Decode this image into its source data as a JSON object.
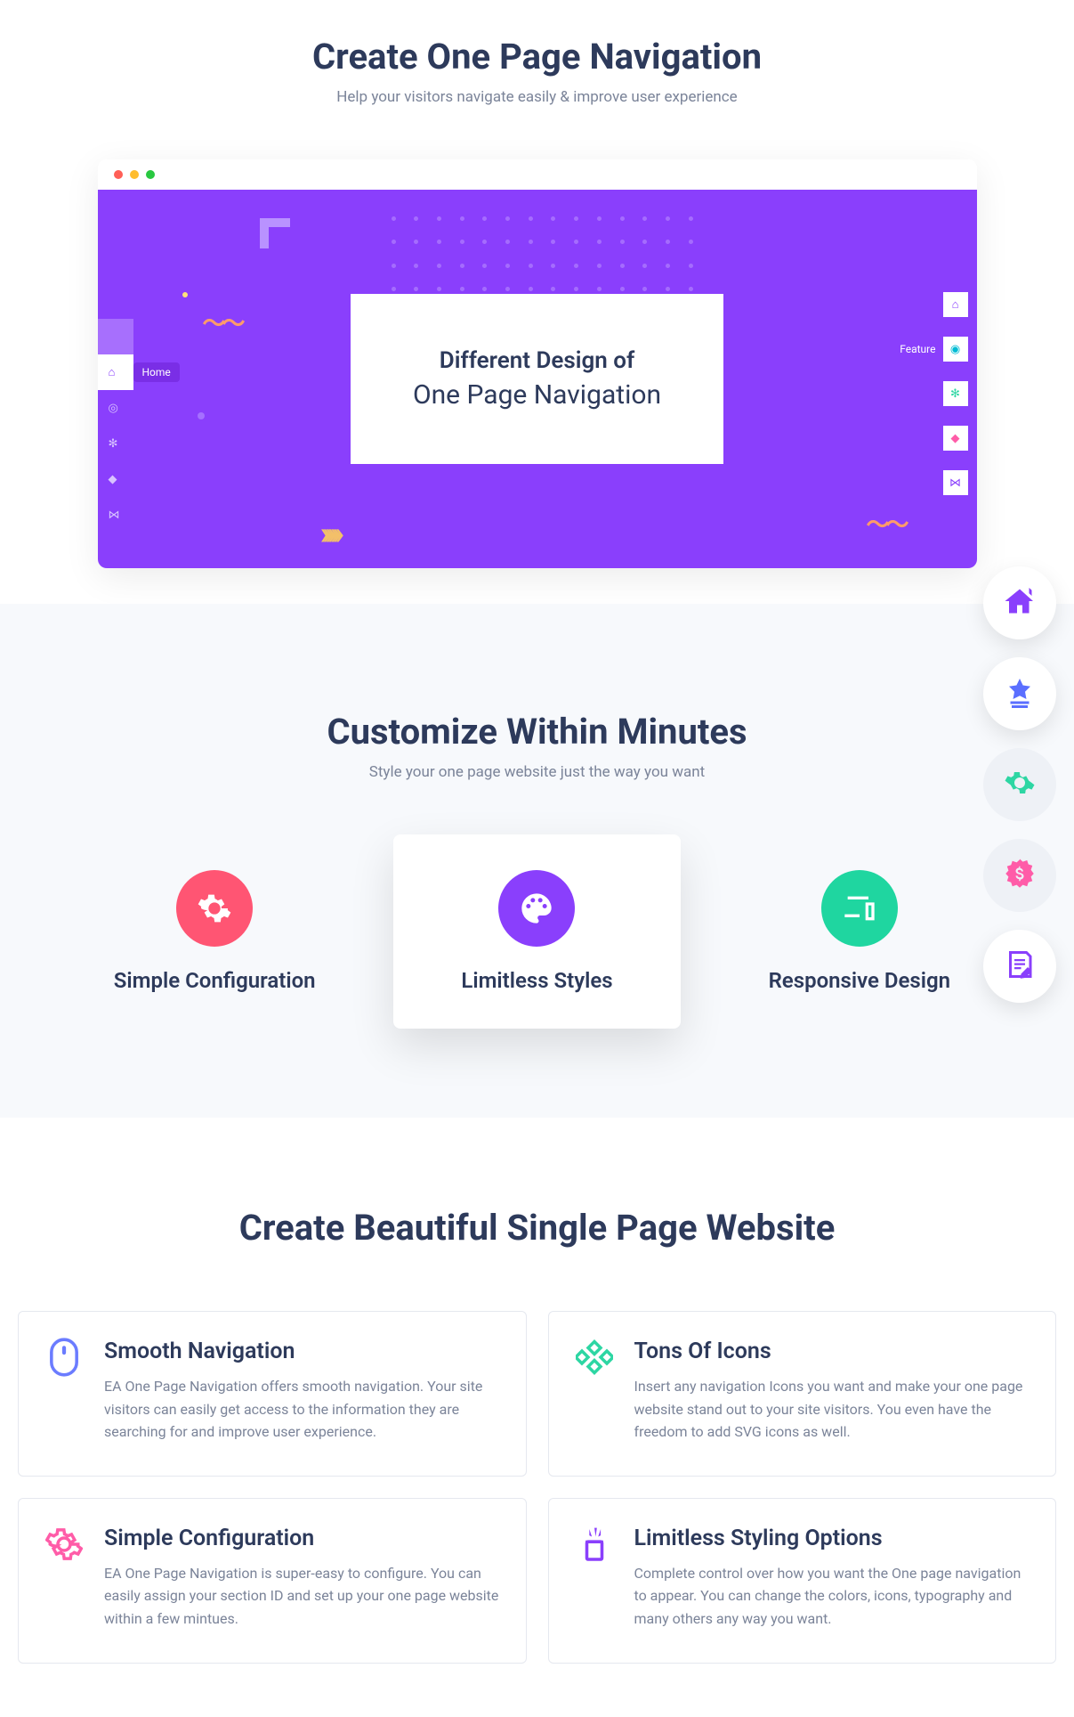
{
  "section1": {
    "heading": "Create One Page Navigation",
    "sub": "Help your visitors navigate easily & improve user experience",
    "hero": {
      "line1": "Different Design of",
      "line2": "One Page Navigation",
      "leftNav": [
        {
          "label": "Home",
          "iconColor": "#8a3ffc"
        },
        {
          "label": "",
          "iconColor": "#8a3ffc"
        },
        {
          "label": "",
          "iconColor": "#8a3ffc"
        },
        {
          "label": "",
          "iconColor": "#8a3ffc"
        },
        {
          "label": "",
          "iconColor": "#8a3ffc"
        }
      ],
      "rightNav": [
        {
          "iconColor": "#8a3ffc",
          "label": ""
        },
        {
          "iconColor": "#00bcd4",
          "label": "Feature"
        },
        {
          "iconColor": "#2dd6a3",
          "label": ""
        },
        {
          "iconColor": "#ff5ca8",
          "label": ""
        },
        {
          "iconColor": "#8a3ffc",
          "label": ""
        }
      ]
    }
  },
  "section2": {
    "heading": "Customize Within Minutes",
    "sub": "Style your one page website just the way you want",
    "features": [
      {
        "title": "Simple Configuration",
        "bg": "#ff5573",
        "icon": "gear"
      },
      {
        "title": "Limitless Styles",
        "bg": "#8a3ffc",
        "icon": "palette"
      },
      {
        "title": "Responsive Design",
        "bg": "#1fd6a0",
        "icon": "devices"
      }
    ]
  },
  "floatNav": [
    {
      "icon": "home",
      "color": "#8a3ffc",
      "bg": "white"
    },
    {
      "icon": "star-underline",
      "color": "#5b6fff",
      "bg": "white"
    },
    {
      "icon": "gear-check",
      "color": "#2dd6a3",
      "bg": "alt"
    },
    {
      "icon": "badge-dollar",
      "color": "#ff5ca8",
      "bg": "alt"
    },
    {
      "icon": "note-edit",
      "color": "#8a3ffc",
      "bg": "white"
    }
  ],
  "section3": {
    "heading": "Create Beautiful Single Page Website",
    "cards": [
      {
        "title": "Smooth Navigation",
        "desc": "EA One Page Navigation offers smooth navigation. Your site visitors can easily get access to the information they are searching for and improve user experience.",
        "icon": "mouse",
        "color": "#6b7cff"
      },
      {
        "title": "Tons Of Icons",
        "desc": "Insert any navigation Icons you want and make your one page website stand out to your site visitors. You even have the freedom to add SVG icons as well.",
        "icon": "diamonds",
        "color": "#2dd6a3"
      },
      {
        "title": "Simple Configuration",
        "desc": "EA One Page Navigation is super-easy to configure. You can easily assign your section ID and set up your one page website within a few mintues.",
        "icon": "gear",
        "color": "#ff5ca8"
      },
      {
        "title": "Limitless Styling Options",
        "desc": "Complete control over how you want the One page navigation to appear. You can change the colors, icons, typography and many others any way you want.",
        "icon": "plant",
        "color": "#8a3ffc"
      }
    ]
  }
}
